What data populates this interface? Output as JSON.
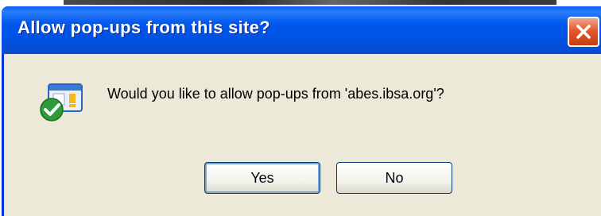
{
  "dialog": {
    "title": "Allow pop-ups from this site?",
    "message": "Would you like to allow pop-ups from 'abes.ibsa.org'?",
    "close_icon": "close-icon",
    "message_icon": "popup-allowed-check-icon",
    "buttons": {
      "yes": "Yes",
      "no": "No"
    }
  },
  "colors": {
    "titlebar": "#0058ee",
    "body": "#ece9d8",
    "close": "#e15a30",
    "check": "#2e9b3a"
  }
}
